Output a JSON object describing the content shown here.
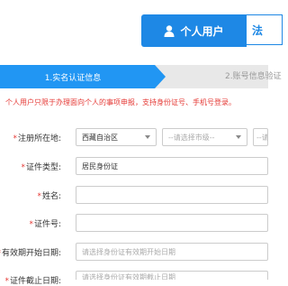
{
  "user_tabs": {
    "personal": "个人用户",
    "legal": "法"
  },
  "steps": {
    "step1": "1.实名认证信息",
    "step2": "2.账号信息验证"
  },
  "notice": "个人用户只限于办理面向个人的事项申报，支持身份证号、手机号登录。",
  "form": {
    "region": {
      "label": "注册所在地:",
      "province": "西藏自治区",
      "city_placeholder": "--请选择市级--",
      "district_placeholder": "--请"
    },
    "id_type": {
      "label": "证件类型:",
      "value": "居民身份证"
    },
    "name": {
      "label": "姓名:"
    },
    "id_number": {
      "label": "证件号:"
    },
    "valid_start": {
      "label": "有效期开始日期:",
      "placeholder": "请选择身份证有效期开始日期"
    },
    "valid_end": {
      "label": "证件截止日期:",
      "placeholder": "请选择身份证有效期截止日期"
    }
  },
  "colors": {
    "primary": "#1e88e5",
    "required": "#e53935"
  }
}
